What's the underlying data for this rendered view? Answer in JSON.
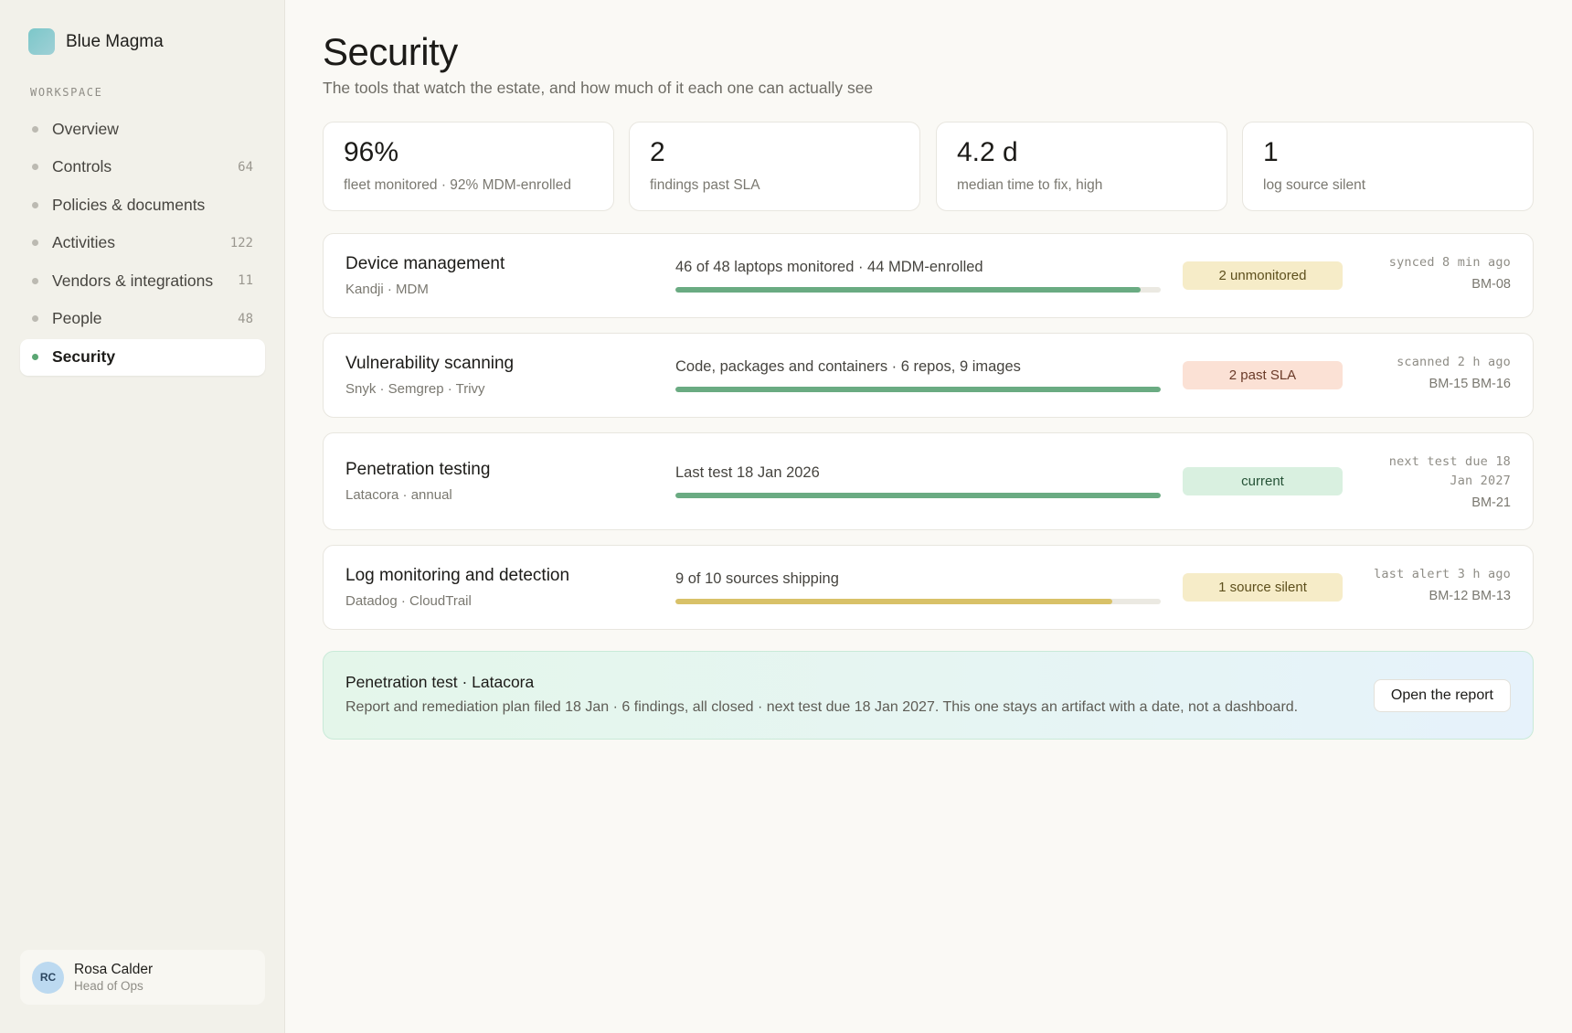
{
  "app": {
    "name": "Blue Magma"
  },
  "sidebar": {
    "section_label": "WORKSPACE",
    "items": [
      {
        "label": "Overview",
        "count": ""
      },
      {
        "label": "Controls",
        "count": "64"
      },
      {
        "label": "Policies & documents",
        "count": ""
      },
      {
        "label": "Activities",
        "count": "122"
      },
      {
        "label": "Vendors & integrations",
        "count": "11"
      },
      {
        "label": "People",
        "count": "48"
      },
      {
        "label": "Security",
        "count": "",
        "active": true
      }
    ]
  },
  "user": {
    "initials": "RC",
    "name": "Rosa Calder",
    "role": "Head of Ops"
  },
  "page": {
    "title": "Security",
    "subtitle": "The tools that watch the estate, and how much of it each one can actually see"
  },
  "stats": [
    {
      "value": "96%",
      "label": "fleet monitored · 92% MDM-enrolled"
    },
    {
      "value": "2",
      "label": "findings past SLA"
    },
    {
      "value": "4.2 d",
      "label": "median time to fix, high"
    },
    {
      "value": "1",
      "label": "log source silent"
    }
  ],
  "tools": [
    {
      "name": "Device management",
      "vendors": "Kandji · MDM",
      "coverage": "46 of 48 laptops monitored · 44 MDM-enrolled",
      "progress": 0.958,
      "bar_color": "#6aab82",
      "badge": "2 unmonitored",
      "badge_bg": "#f6ecc8",
      "badge_color": "#5d4f1c",
      "meta_status": "synced 8 min ago",
      "meta_status_2": "",
      "meta_ids": "BM-08"
    },
    {
      "name": "Vulnerability scanning",
      "vendors": "Snyk · Semgrep · Trivy",
      "coverage": "Code, packages and containers · 6 repos, 9 images",
      "progress": 1.0,
      "bar_color": "#6aab82",
      "badge": "2 past SLA",
      "badge_bg": "#fbe1d5",
      "badge_color": "#6a3a28",
      "meta_status": "scanned 2 h ago",
      "meta_status_2": "",
      "meta_ids": "BM-15 BM-16"
    },
    {
      "name": "Penetration testing",
      "vendors": "Latacora · annual",
      "coverage": "Last test 18 Jan 2026",
      "progress": 1.0,
      "bar_color": "#6aab82",
      "badge": "current",
      "badge_bg": "#d9f0e0",
      "badge_color": "#255236",
      "meta_status": "next test due 18",
      "meta_status_2": "Jan 2027",
      "meta_ids": "BM-21"
    },
    {
      "name": "Log monitoring and detection",
      "vendors": "Datadog · CloudTrail",
      "coverage": "9 of 10 sources shipping",
      "progress": 0.9,
      "bar_color": "#d8c168",
      "badge": "1 source silent",
      "badge_bg": "#f6ecc8",
      "badge_color": "#5d4f1c",
      "meta_status": "last alert 3 h ago",
      "meta_status_2": "",
      "meta_ids": "BM-12 BM-13"
    }
  ],
  "banner": {
    "title": "Penetration test · Latacora",
    "body": "Report and remediation plan filed 18 Jan · 6 findings, all closed · next test due 18 Jan 2027. This one stays an artifact with a date, not a dashboard.",
    "button": "Open the report"
  }
}
